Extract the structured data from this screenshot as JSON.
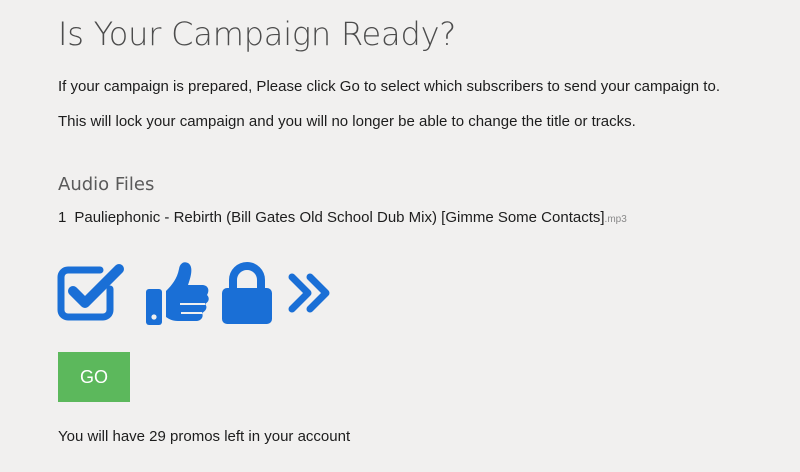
{
  "page": {
    "title": "Is Your Campaign Ready?",
    "intro_line_1": "If your campaign is prepared, Please click Go to select which subscribers to send your campaign to.",
    "intro_line_2": "This will lock your campaign and you will no longer be able to change the title or tracks."
  },
  "audio_files": {
    "heading": "Audio Files",
    "tracks": [
      {
        "number": "1",
        "name": "Pauliephonic - Rebirth (Bill Gates Old School Dub Mix) [Gimme Some Contacts]",
        "extension": ".mp3"
      }
    ]
  },
  "icons": [
    "checkbox-icon",
    "thumbs-up-icon",
    "lock-icon",
    "double-chevron-right-icon"
  ],
  "actions": {
    "go_label": "GO"
  },
  "account": {
    "promos_text": "You will have 29 promos left in your account"
  },
  "colors": {
    "background": "#f1f0ef",
    "icon_blue": "#1a6fd6",
    "go_button": "#5cb85c",
    "title_text": "#4c4c4c"
  }
}
